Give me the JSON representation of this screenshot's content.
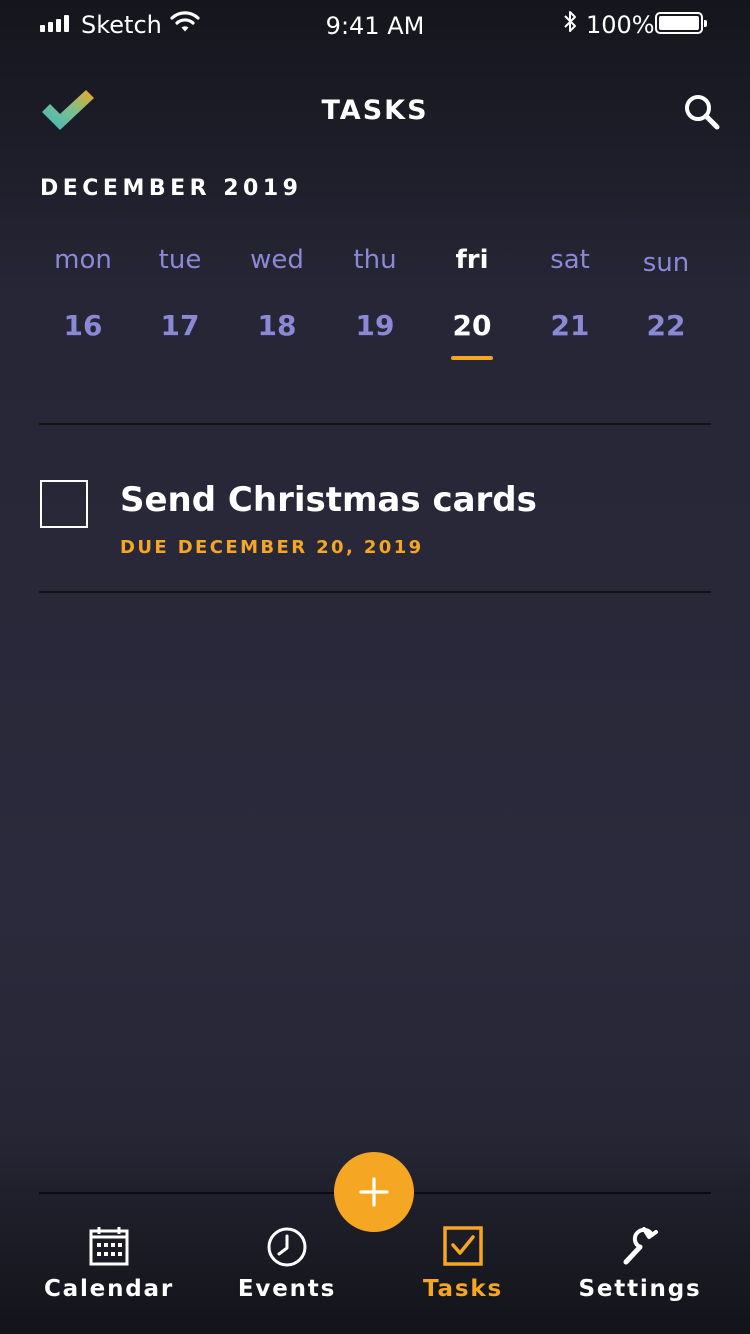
{
  "status_bar": {
    "carrier": "Sketch",
    "time": "9:41 AM",
    "battery": "100%"
  },
  "header": {
    "title": "TASKS",
    "logo_icon": "checkmark-logo-icon",
    "search_icon": "search-icon"
  },
  "month_label": "DECEMBER 2019",
  "week": [
    {
      "name": "mon",
      "date": "16"
    },
    {
      "name": "tue",
      "date": "17"
    },
    {
      "name": "wed",
      "date": "18"
    },
    {
      "name": "thu",
      "date": "19"
    },
    {
      "name": "fri",
      "date": "20"
    },
    {
      "name": "sat",
      "date": "21"
    },
    {
      "name": "sun",
      "date": "22"
    }
  ],
  "selected_day": "fri",
  "tasks": [
    {
      "title": "Send Christmas cards",
      "due": "DUE DECEMBER 20, 2019",
      "done": false
    }
  ],
  "fab_icon": "plus-icon",
  "tab_bar": [
    {
      "label": "Calendar",
      "icon": "calendar-icon"
    },
    {
      "label": "Events",
      "icon": "clock-icon"
    },
    {
      "label": "Tasks",
      "icon": "checkbox-icon"
    },
    {
      "label": "Settings",
      "icon": "wrench-icon"
    }
  ],
  "active_tab": "Tasks",
  "colors": {
    "accent": "#f5a623",
    "day_text": "#8b88d6",
    "background": "#262636",
    "logo_teal": "#3bb8c4"
  }
}
